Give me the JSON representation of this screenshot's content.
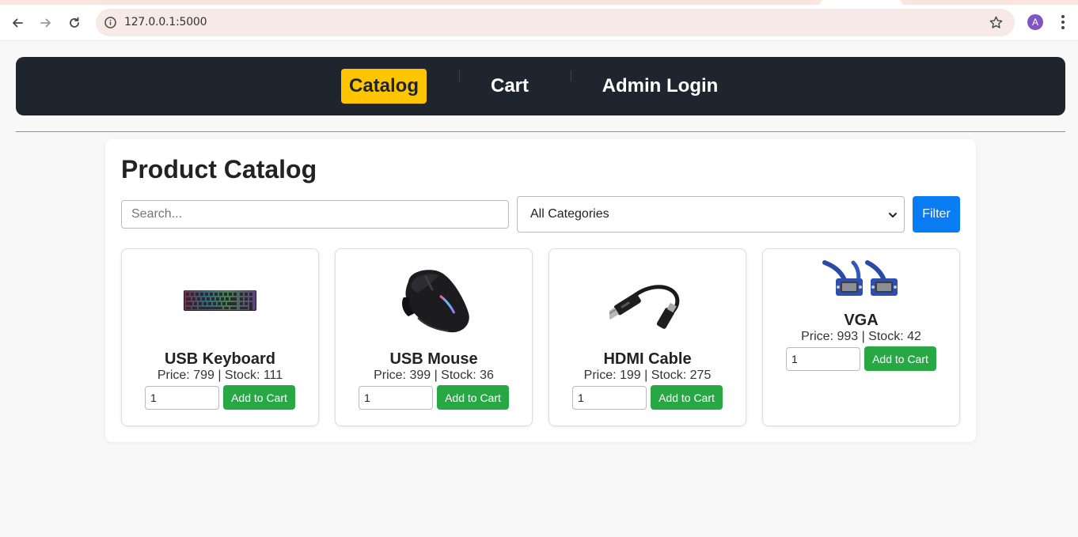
{
  "browser": {
    "url": "127.0.0.1:5000",
    "profile_initial": "A"
  },
  "nav": {
    "links": [
      {
        "label": "Catalog",
        "active": true
      },
      {
        "label": "Cart",
        "active": false
      },
      {
        "label": "Admin Login",
        "active": false
      }
    ]
  },
  "catalog": {
    "title": "Product Catalog",
    "search_placeholder": "Search...",
    "category_selected": "All Categories",
    "filter_label": "Filter"
  },
  "products": [
    {
      "name": "USB Keyboard",
      "info": "Price: 799 | Stock: 111",
      "qty": "1",
      "button": "Add to Cart",
      "image_icon": "keyboard-icon"
    },
    {
      "name": "USB Mouse",
      "info": "Price: 399 | Stock: 36",
      "qty": "1",
      "button": "Add to Cart",
      "image_icon": "mouse-icon"
    },
    {
      "name": "HDMI Cable",
      "info": "Price: 199 | Stock: 275",
      "qty": "1",
      "button": "Add to Cart",
      "image_icon": "hdmi-cable-icon"
    },
    {
      "name": "VGA",
      "info": "Price: 993 | Stock: 42",
      "qty": "1",
      "button": "Add to Cart",
      "image_icon": "vga-cable-icon"
    }
  ],
  "colors": {
    "navbar_bg": "#1e252e",
    "active_link_bg": "#ffc500",
    "filter_button": "#0a7cf3",
    "add_to_cart_button": "#28a745"
  }
}
